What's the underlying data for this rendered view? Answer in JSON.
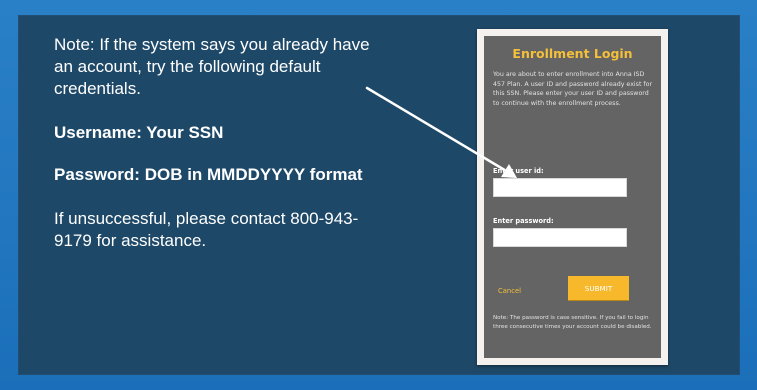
{
  "instructions": {
    "note": "Note: If the system says you already have an account, try the following default credentials.",
    "username": "Username: Your SSN",
    "password": "Password: DOB in MMDDYYYY format",
    "contact": "If unsuccessful, please contact 800-943-9179 for assistance."
  },
  "login": {
    "title": "Enrollment Login",
    "description": "You are about to enter enrollment into Anna ISD 457 Plan. A user ID and password already exist for this SSN. Please enter your user ID and password to continue with the enrollment process.",
    "user_id_label": "Enter user id:",
    "user_id_value": "",
    "password_label": "Enter password:",
    "password_value": "",
    "cancel_label": "Cancel",
    "submit_label": "SUBMIT",
    "footnote": "Note: The password is case sensitive. If you fail to login three consecutive times your account could be disabled."
  },
  "colors": {
    "background": "#1f73bd",
    "panel": "#1e4868",
    "card": "#646464",
    "accent": "#f4bf3a",
    "submit": "#f7b92b"
  }
}
